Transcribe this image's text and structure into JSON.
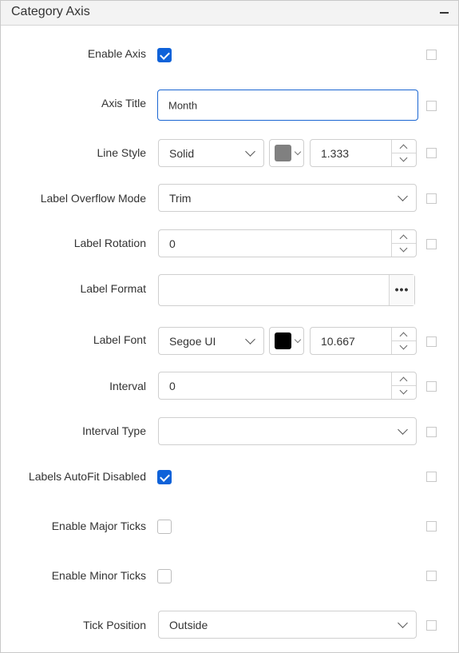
{
  "panel": {
    "title": "Category Axis",
    "collapse_icon": "minus-icon"
  },
  "rows": {
    "enable_axis": {
      "label": "Enable Axis",
      "checked": true
    },
    "axis_title": {
      "label": "Axis Title",
      "value": "Month",
      "placeholder": ""
    },
    "line_style": {
      "label": "Line Style",
      "style": "Solid",
      "color": "#808080",
      "width": "1.333"
    },
    "label_overflow_mode": {
      "label": "Label Overflow Mode",
      "value": "Trim"
    },
    "label_rotation": {
      "label": "Label Rotation",
      "value": "0"
    },
    "label_format": {
      "label": "Label Format",
      "value": "",
      "button_label": "•••"
    },
    "label_font": {
      "label": "Label Font",
      "font": "Segoe UI",
      "color": "#000000",
      "size": "10.667"
    },
    "interval": {
      "label": "Interval",
      "value": "0"
    },
    "interval_type": {
      "label": "Interval Type",
      "value": ""
    },
    "labels_autofit_disabled": {
      "label": "Labels AutoFit Disabled",
      "checked": true
    },
    "enable_major_ticks": {
      "label": "Enable Major Ticks",
      "checked": false
    },
    "enable_minor_ticks": {
      "label": "Enable Minor Ticks",
      "checked": false
    },
    "tick_position": {
      "label": "Tick Position",
      "value": "Outside"
    }
  },
  "colors": {
    "accent": "#0f62d9",
    "header_bg": "#f3f3f3",
    "border": "#cfcfcf"
  }
}
